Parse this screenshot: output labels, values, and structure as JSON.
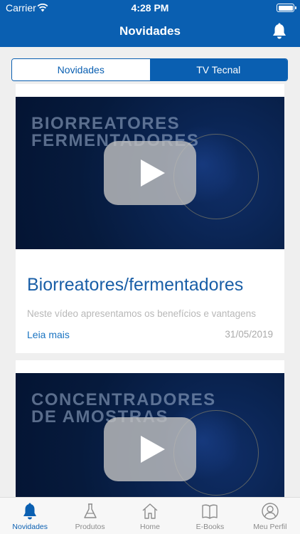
{
  "status_bar": {
    "carrier": "Carrier",
    "time": "4:28 PM"
  },
  "nav": {
    "title": "Novidades"
  },
  "segments": [
    {
      "label": "Novidades",
      "active": true
    },
    {
      "label": "TV Tecnal",
      "active": false
    }
  ],
  "cards": [
    {
      "thumb_banner_line1": "BIORREATORES",
      "thumb_banner_line2": "FERMENTADORES",
      "title": "Biorreatores/fermentadores",
      "excerpt": "Neste vídeo apresentamos os benefícios e vantagens",
      "more_label": "Leia mais",
      "date": "31/05/2019"
    },
    {
      "thumb_banner_line1": "CONCENTRADORES",
      "thumb_banner_line2": "DE AMOSTRAS"
    }
  ],
  "tabbar": [
    {
      "label": "Novidades",
      "icon": "bell-icon",
      "active": true
    },
    {
      "label": "Produtos",
      "icon": "flask-icon",
      "active": false
    },
    {
      "label": "Home",
      "icon": "home-icon",
      "active": false
    },
    {
      "label": "E-Books",
      "icon": "book-icon",
      "active": false
    },
    {
      "label": "Meu Perfil",
      "icon": "profile-icon",
      "active": false
    }
  ],
  "colors": {
    "brand": "#0a5fb1",
    "link": "#1a74c2",
    "title": "#1a5fa7"
  }
}
